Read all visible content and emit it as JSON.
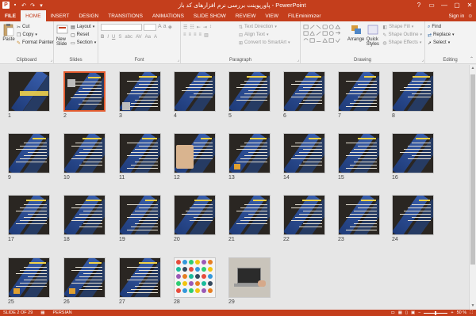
{
  "window": {
    "title": "پاورپوینت بررسی نرم افزارهای کد باز  -  PowerPoint",
    "controls": [
      "?",
      "▭",
      "—",
      "▢",
      "✕"
    ]
  },
  "tabs": [
    "FILE",
    "HOME",
    "INSERT",
    "DESIGN",
    "TRANSITIONS",
    "ANIMATIONS",
    "SLIDE SHOW",
    "REVIEW",
    "VIEW",
    "FILEminimizer"
  ],
  "active_tab": "HOME",
  "signin": "Sign in",
  "ribbon": {
    "clipboard": {
      "label": "Clipboard",
      "paste": "Paste",
      "cut": "Cut",
      "copy": "Copy",
      "format_painter": "Format Painter"
    },
    "slides": {
      "label": "Slides",
      "new_slide": "New Slide",
      "layout": "Layout",
      "reset": "Reset",
      "section": "Section"
    },
    "font": {
      "label": "Font"
    },
    "paragraph": {
      "label": "Paragraph",
      "text_direction": "Text Direction",
      "align_text": "Align Text",
      "convert": "Convert to SmartArt"
    },
    "drawing": {
      "label": "Drawing",
      "arrange": "Arrange",
      "quick_styles": "Quick Styles",
      "shape_fill": "Shape Fill",
      "shape_outline": "Shape Outline",
      "shape_effects": "Shape Effects"
    },
    "editing": {
      "label": "Editing",
      "find": "Find",
      "replace": "Replace",
      "select": "Select"
    }
  },
  "slides": [
    {
      "n": "1"
    },
    {
      "n": "2"
    },
    {
      "n": "3"
    },
    {
      "n": "4"
    },
    {
      "n": "5"
    },
    {
      "n": "6"
    },
    {
      "n": "7"
    },
    {
      "n": "8"
    },
    {
      "n": "9"
    },
    {
      "n": "10"
    },
    {
      "n": "11"
    },
    {
      "n": "12"
    },
    {
      "n": "13"
    },
    {
      "n": "14"
    },
    {
      "n": "15"
    },
    {
      "n": "16"
    },
    {
      "n": "17"
    },
    {
      "n": "18"
    },
    {
      "n": "19"
    },
    {
      "n": "20"
    },
    {
      "n": "21"
    },
    {
      "n": "22"
    },
    {
      "n": "23"
    },
    {
      "n": "24"
    },
    {
      "n": "25"
    },
    {
      "n": "26"
    },
    {
      "n": "27"
    },
    {
      "n": "28"
    },
    {
      "n": "29"
    }
  ],
  "selected_slide": 2,
  "status": {
    "slide_counter": "SLIDE 2 OF 29",
    "language": "PERSIAN",
    "zoom": "50 %"
  },
  "colors": {
    "brand": "#c43e1c",
    "selection": "#e25b2f"
  }
}
